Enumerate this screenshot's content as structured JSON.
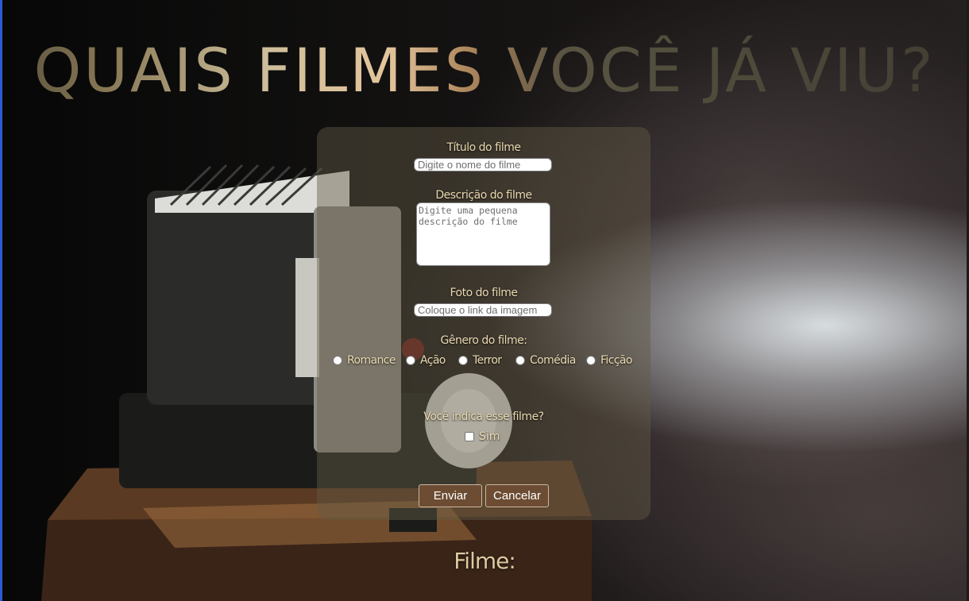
{
  "header": {
    "title": "QUAIS FILMES VOCÊ JÁ VIU?"
  },
  "form": {
    "title_label": "Título do filme",
    "title_placeholder": "Digite o nome do filme",
    "description_label": "Descrição do filme",
    "description_placeholder": "Digite uma pequena descrição do filme",
    "photo_label": "Foto do filme",
    "photo_placeholder": "Coloque o link da imagem",
    "genre_label": "Gênero do filme:",
    "genres": [
      "Romance",
      "Ação",
      "Terror",
      "Comédia",
      "Ficção"
    ],
    "recommend_label": "Você indica esse filme?",
    "recommend_option": "Sim",
    "submit_label": "Enviar",
    "cancel_label": "Cancelar"
  },
  "results": {
    "heading": "Filme:"
  },
  "colors": {
    "panel": "#645c48",
    "label_text": "#ebd9b0",
    "button_bg": "#6c4c32",
    "button_text": "#ffffff"
  }
}
